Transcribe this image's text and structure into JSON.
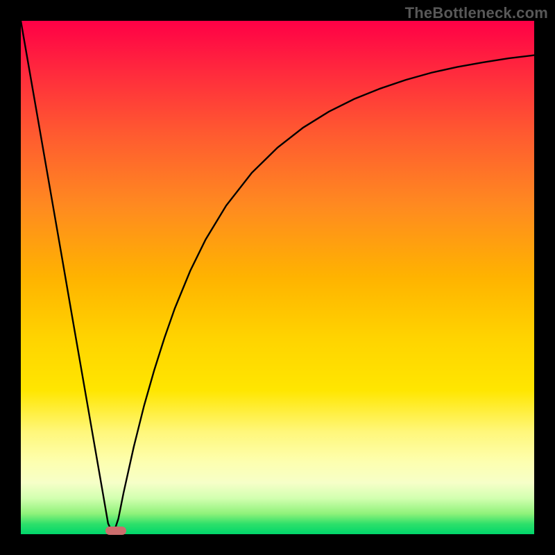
{
  "watermark": "TheBottleneck.com",
  "colors": {
    "marker": "#cc6d6d",
    "curve": "#000000",
    "frame": "#000000"
  },
  "chart_data": {
    "type": "line",
    "title": "",
    "xlabel": "",
    "ylabel": "",
    "xlim": [
      0,
      100
    ],
    "ylim": [
      0,
      100
    ],
    "grid": false,
    "legend": false,
    "annotations": [],
    "series": [
      {
        "name": "bottleneck-curve",
        "x": [
          0,
          2,
          4,
          6,
          8,
          10,
          12,
          14,
          16,
          17,
          18,
          19,
          20,
          22,
          24,
          26,
          28,
          30,
          33,
          36,
          40,
          45,
          50,
          55,
          60,
          65,
          70,
          75,
          80,
          85,
          90,
          95,
          100
        ],
        "y": [
          100,
          88.5,
          77,
          65.5,
          54,
          42.4,
          30.9,
          19.4,
          7.9,
          2.1,
          0,
          3,
          8,
          17,
          25,
          32,
          38.3,
          44,
          51.3,
          57.4,
          64,
          70.4,
          75.3,
          79.2,
          82.3,
          84.8,
          86.8,
          88.5,
          89.9,
          91,
          91.9,
          92.7,
          93.3
        ]
      }
    ],
    "marker": {
      "x_start": 16.5,
      "x_end": 20.5,
      "y": 0
    }
  }
}
